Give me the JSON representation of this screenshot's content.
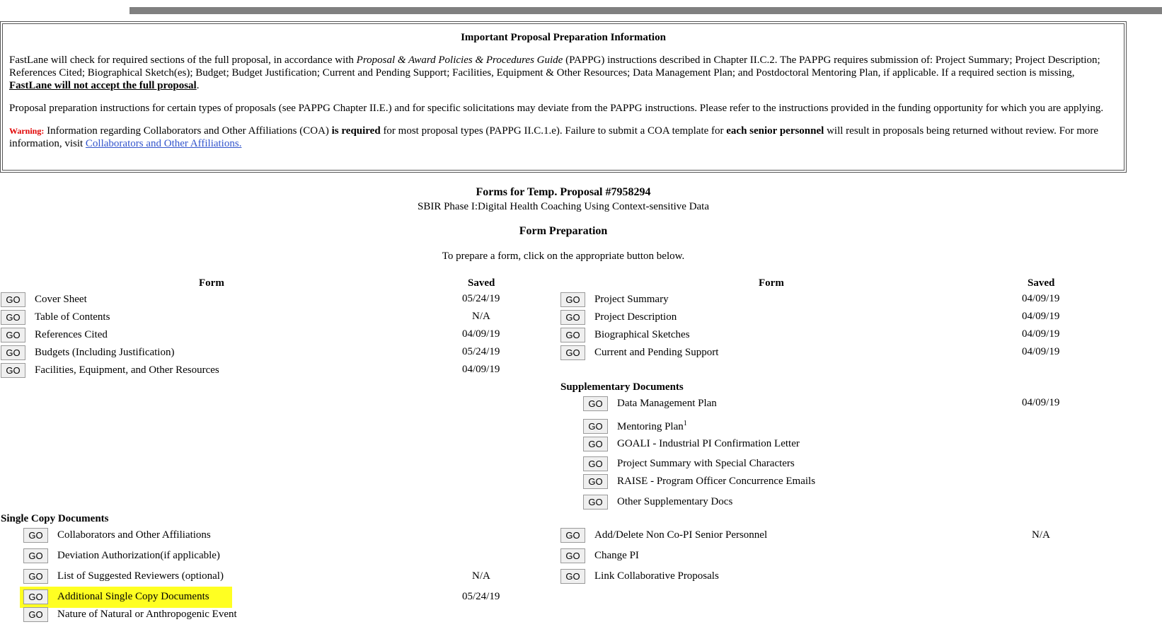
{
  "info": {
    "title": "Important Proposal Preparation Information",
    "p1_a": "FastLane will check for required sections of the full proposal, in accordance with ",
    "p1_em": "Proposal & Award Policies & Procedures Guide",
    "p1_b": " (PAPPG) instructions described in Chapter II.C.2. The PAPPG requires submission of: Project Summary; Project Description; References Cited; Biographical Sketch(es); Budget; Budget Justification; Current and Pending Support; Facilities, Equipment & Other Resources; Data Management Plan; and Postdoctoral Mentoring Plan, if applicable. If a required section is missing, ",
    "p1_strong": "FastLane will not accept the full proposal",
    "p1_end": ".",
    "p2": "Proposal preparation instructions for certain types of proposals (see PAPPG Chapter II.E.) and for specific solicitations may deviate from the PAPPG instructions. Please refer to the instructions provided in the funding opportunity for which you are applying.",
    "warning_label": "Warning:",
    "p3_a": " Information regarding Collaborators and Other Affiliations (COA) ",
    "p3_b1": "is required",
    "p3_c": " for most proposal types (PAPPG II.C.1.e). Failure to submit a COA template for ",
    "p3_b2": "each senior personnel",
    "p3_d": " will result in proposals being returned without review. For more information, visit ",
    "p3_link": "Collaborators and Other Affiliations."
  },
  "forms_title": "Forms for Temp. Proposal #7958294",
  "proposal_subtitle": "SBIR Phase I:Digital Health Coaching Using Context-sensitive Data",
  "prep_title": "Form Preparation",
  "prep_instruction": "To prepare a form, click on the appropriate button below.",
  "headers": {
    "form": "Form",
    "saved": "Saved"
  },
  "go_label": "GO",
  "left_forms": [
    {
      "label": "Cover Sheet",
      "saved": "05/24/19"
    },
    {
      "label": "Table of Contents",
      "saved": "N/A"
    },
    {
      "label": "References Cited",
      "saved": "04/09/19"
    },
    {
      "label": "Budgets (Including Justification)",
      "saved": "05/24/19"
    },
    {
      "label": "Facilities, Equipment, and Other Resources",
      "saved": "04/09/19"
    }
  ],
  "right_forms": [
    {
      "label": "Project Summary",
      "saved": "04/09/19"
    },
    {
      "label": "Project Description",
      "saved": "04/09/19"
    },
    {
      "label": "Biographical Sketches",
      "saved": "04/09/19"
    },
    {
      "label": "Current and Pending Support",
      "saved": "04/09/19"
    }
  ],
  "supplementary": {
    "title": "Supplementary Documents",
    "items": [
      {
        "label": "Data Management Plan",
        "saved": "04/09/19"
      },
      {
        "label": "Mentoring Plan",
        "sup": "1",
        "saved": ""
      },
      {
        "label": "GOALI - Industrial PI Confirmation Letter",
        "saved": ""
      },
      {
        "label": "Project Summary with Special Characters",
        "saved": ""
      },
      {
        "label": "RAISE - Program Officer Concurrence Emails",
        "saved": ""
      },
      {
        "label": "Other Supplementary Docs",
        "saved": ""
      }
    ]
  },
  "single_copy": {
    "title": "Single Copy Documents",
    "items": [
      {
        "label": "Collaborators and Other Affiliations",
        "saved": ""
      },
      {
        "label": "Deviation Authorization(if applicable)",
        "saved": ""
      },
      {
        "label": "List of Suggested Reviewers (optional)",
        "saved": "N/A"
      },
      {
        "label": "Additional Single Copy Documents",
        "saved": "05/24/19",
        "highlighted": true
      },
      {
        "label": "Nature of Natural or Anthropogenic Event",
        "saved": ""
      }
    ]
  },
  "right_bottom": [
    {
      "label": "Add/Delete Non Co-PI Senior Personnel",
      "saved": "N/A"
    },
    {
      "label": "Change PI",
      "saved": ""
    },
    {
      "label": "Link Collaborative Proposals",
      "saved": ""
    }
  ],
  "highlight_color": "#ffff22"
}
